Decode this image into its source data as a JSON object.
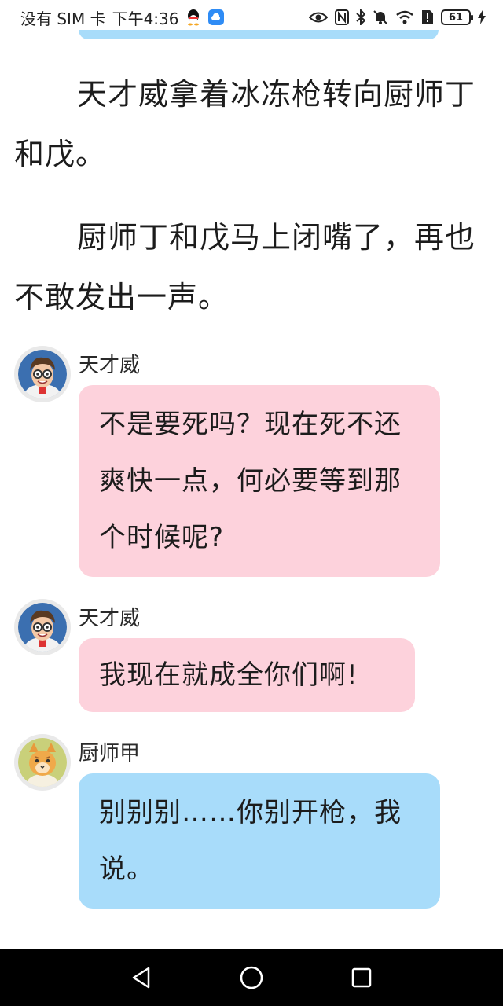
{
  "status_bar": {
    "carrier": "没有 SIM 卡",
    "time": "下午4:36",
    "battery_level": "61",
    "left_icons": [
      "qq-icon",
      "cloud-app-icon"
    ],
    "right_icons": [
      "eye-icon",
      "nfc-icon",
      "bluetooth-icon",
      "mute-bell-icon",
      "wifi-icon",
      "sim-alert-icon",
      "battery-icon",
      "charging-icon"
    ]
  },
  "narration": [
    "天才威拿着冰冻枪转向厨师丁和戊。",
    "厨师丁和戊马上闭嘴了，再也不敢发出一声。"
  ],
  "messages": [
    {
      "speaker": "天才威",
      "text": "不是要死吗？现在死不还爽快一点，何必要等到那个时候呢?",
      "color": "#fdd2dc",
      "avatar": "boy-avatar"
    },
    {
      "speaker": "天才威",
      "text": "我现在就成全你们啊!",
      "color": "#fdd2dc",
      "avatar": "boy-avatar"
    },
    {
      "speaker": "厨师甲",
      "text": "别别别……你别开枪，我说。",
      "color": "#a8dcfa",
      "avatar": "cat-chef-avatar"
    }
  ],
  "nav_bar": {
    "buttons": [
      "back-icon",
      "home-icon",
      "recents-icon"
    ]
  }
}
